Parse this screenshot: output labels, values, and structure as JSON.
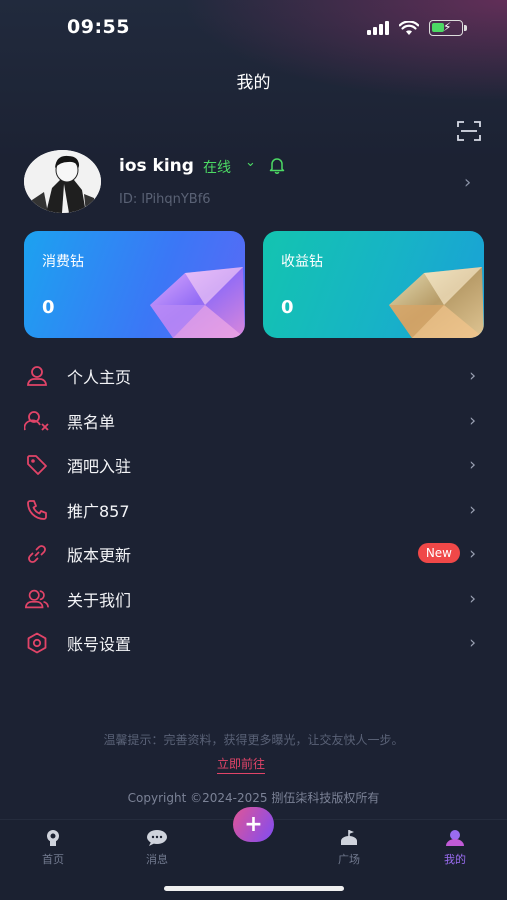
{
  "status_bar": {
    "time": "09:55"
  },
  "header": {
    "title": "我的"
  },
  "profile": {
    "username": "ios king",
    "status": "在线",
    "user_id": "ID: lPihqnYBf6"
  },
  "wallets": [
    {
      "label": "消费钻",
      "value": "0"
    },
    {
      "label": "收益钻",
      "value": "0"
    }
  ],
  "menu": {
    "items": [
      {
        "label": "个人主页",
        "icon": "person-icon"
      },
      {
        "label": "黑名单",
        "icon": "block-user-icon"
      },
      {
        "label": "酒吧入驻",
        "icon": "tag-icon"
      },
      {
        "label": "推广857",
        "icon": "phone-icon"
      },
      {
        "label": "版本更新",
        "icon": "link-icon",
        "badge": "New"
      },
      {
        "label": "关于我们",
        "icon": "group-icon"
      },
      {
        "label": "账号设置",
        "icon": "settings-hexagon-icon"
      }
    ]
  },
  "footer": {
    "tip": "温馨提示：完善资料，获得更多曝光，让交友快人一步。",
    "goto": "立即前往",
    "copyright": "Copyright ©2024-2025 捌伍柒科技版权所有"
  },
  "tabbar": {
    "tabs": [
      {
        "label": "首页",
        "active": false
      },
      {
        "label": "消息",
        "active": false
      },
      {
        "label": "广场",
        "active": false
      },
      {
        "label": "我的",
        "active": true
      }
    ],
    "center_symbol": "+"
  },
  "colors": {
    "background": "#1c2233",
    "accent_pink": "#e14468",
    "online_green": "#4cd964",
    "badge_red": "#f04848",
    "active_tab": "#9a6cf0"
  }
}
